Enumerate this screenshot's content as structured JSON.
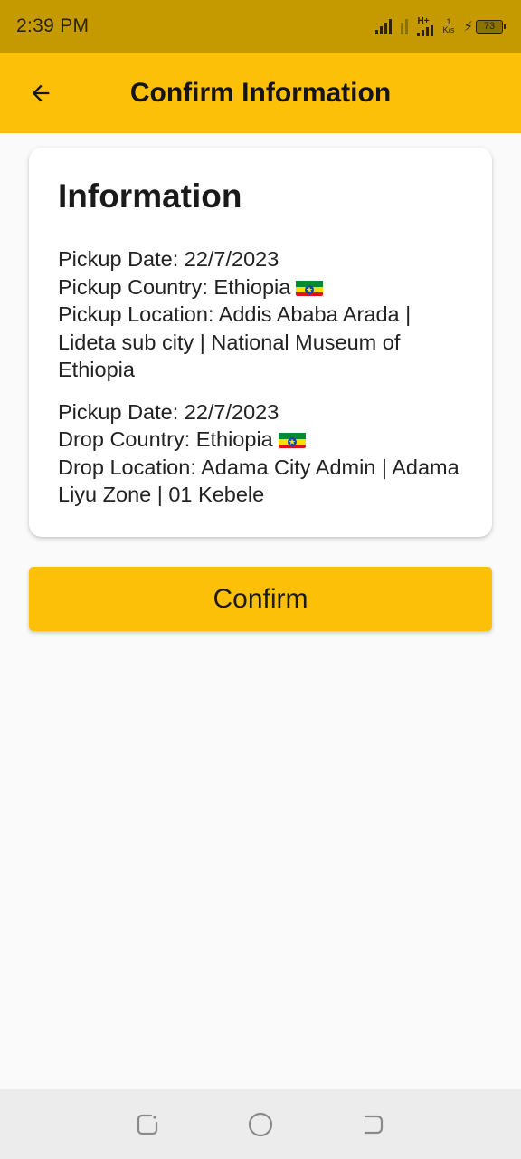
{
  "status_bar": {
    "time": "2:39 PM",
    "network_type": "H+",
    "speed_value": "1",
    "speed_unit": "K/s",
    "battery_level": "73",
    "charging": true
  },
  "app_bar": {
    "title": "Confirm Information",
    "back_icon": "arrow-back-icon"
  },
  "card": {
    "title": "Information",
    "pickup": {
      "date": "Pickup Date: 22/7/2023",
      "country": "Pickup Country: Ethiopia",
      "location": "Pickup Location: Addis Ababa Arada | Lideta sub city | National Museum of Ethiopia"
    },
    "drop": {
      "date": "Pickup Date: 22/7/2023",
      "country": "Drop Country: Ethiopia",
      "location": "Drop Location: Adama City Admin | Adama Liyu Zone | 01 Kebele"
    },
    "flag_icon": "ethiopia-flag-icon"
  },
  "confirm_button": {
    "label": "Confirm"
  },
  "nav_bar": {
    "items": [
      "recent-apps-icon",
      "home-icon",
      "back-icon"
    ]
  },
  "colors": {
    "primary": "#fdc009",
    "status_bar": "#c49a00",
    "background": "#fafafa"
  }
}
